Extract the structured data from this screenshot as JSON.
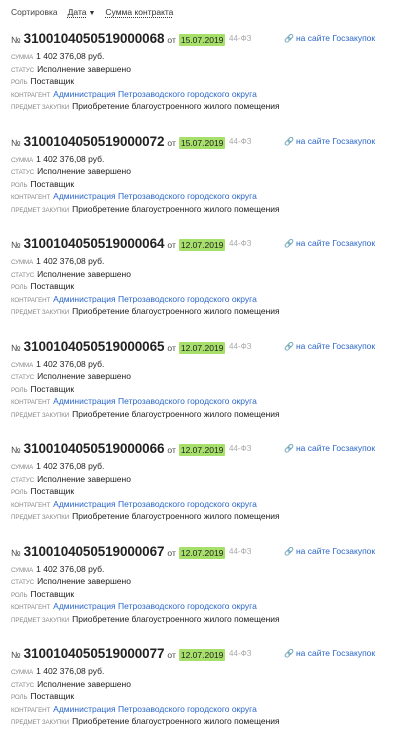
{
  "sort": {
    "label": "Сортировка",
    "options": [
      {
        "label": "Дата",
        "arrow": "▼"
      },
      {
        "label": "Сумма контракта",
        "arrow": ""
      }
    ]
  },
  "labels": {
    "no_prefix": "№",
    "from": "от",
    "sum": "СУММА",
    "status": "СТАТУС",
    "role": "РОЛЬ",
    "counterparty": "КОНТРАГЕНТ",
    "subject": "ПРЕДМЕТ ЗАКУПКИ",
    "link_icon": "🔗",
    "link_text": "на сайте Госзакупок"
  },
  "contracts": [
    {
      "number": "3100104050519000068",
      "date": "15.07.2019",
      "law": "44-ФЗ",
      "sum": "1 402 376,08 руб.",
      "status": "Исполнение завершено",
      "role": "Поставщик",
      "counterparty": "Администрация Петрозаводского городского округа",
      "subject": "Приобретение благоустроенного жилого помещения"
    },
    {
      "number": "3100104050519000072",
      "date": "15.07.2019",
      "law": "44-ФЗ",
      "sum": "1 402 376,08 руб.",
      "status": "Исполнение завершено",
      "role": "Поставщик",
      "counterparty": "Администрация Петрозаводского городского округа",
      "subject": "Приобретение благоустроенного жилого помещения"
    },
    {
      "number": "3100104050519000064",
      "date": "12.07.2019",
      "law": "44-ФЗ",
      "sum": "1 402 376,08 руб.",
      "status": "Исполнение завершено",
      "role": "Поставщик",
      "counterparty": "Администрация Петрозаводского городского округа",
      "subject": "Приобретение благоустроенного жилого помещения"
    },
    {
      "number": "3100104050519000065",
      "date": "12.07.2019",
      "law": "44-ФЗ",
      "sum": "1 402 376,08 руб.",
      "status": "Исполнение завершено",
      "role": "Поставщик",
      "counterparty": "Администрация Петрозаводского городского округа",
      "subject": "Приобретение благоустроенного жилого помещения"
    },
    {
      "number": "3100104050519000066",
      "date": "12.07.2019",
      "law": "44-ФЗ",
      "sum": "1 402 376,08 руб.",
      "status": "Исполнение завершено",
      "role": "Поставщик",
      "counterparty": "Администрация Петрозаводского городского округа",
      "subject": "Приобретение благоустроенного жилого помещения"
    },
    {
      "number": "3100104050519000067",
      "date": "12.07.2019",
      "law": "44-ФЗ",
      "sum": "1 402 376,08 руб.",
      "status": "Исполнение завершено",
      "role": "Поставщик",
      "counterparty": "Администрация Петрозаводского городского округа",
      "subject": "Приобретение благоустроенного жилого помещения"
    },
    {
      "number": "3100104050519000077",
      "date": "12.07.2019",
      "law": "44-ФЗ",
      "sum": "1 402 376,08 руб.",
      "status": "Исполнение завершено",
      "role": "Поставщик",
      "counterparty": "Администрация Петрозаводского городского округа",
      "subject": "Приобретение благоустроенного жилого помещения"
    }
  ],
  "colors": {
    "date_highlight": "#a6e06a",
    "link": "#2a66c9"
  }
}
